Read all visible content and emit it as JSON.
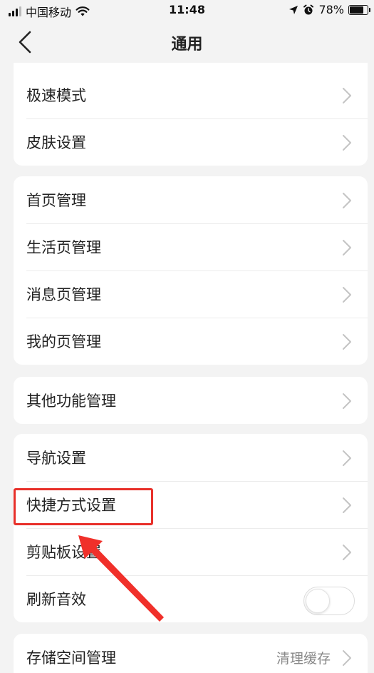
{
  "status_bar": {
    "carrier": "中国移动",
    "time": "11:48",
    "battery": "78%",
    "battery_level": 0.78
  },
  "nav": {
    "title": "通用",
    "back_icon": "chevron-left-icon"
  },
  "groups": [
    {
      "items": [
        {
          "label": "极速模式"
        },
        {
          "label": "皮肤设置"
        }
      ]
    },
    {
      "items": [
        {
          "label": "首页管理"
        },
        {
          "label": "生活页管理"
        },
        {
          "label": "消息页管理"
        },
        {
          "label": "我的页管理"
        }
      ]
    },
    {
      "items": [
        {
          "label": "其他功能管理"
        }
      ]
    },
    {
      "items": [
        {
          "label": "导航设置"
        },
        {
          "label": "快捷方式设置"
        },
        {
          "label": "剪贴板设置"
        },
        {
          "label": "刷新音效",
          "toggle": false
        }
      ]
    },
    {
      "items": [
        {
          "label": "存储空间管理",
          "extra": "清理缓存"
        }
      ]
    }
  ],
  "colors": {
    "background": "#f3f3f3",
    "card": "#ffffff",
    "highlight": "#e8302a",
    "chevron": "#c4c4c4"
  }
}
